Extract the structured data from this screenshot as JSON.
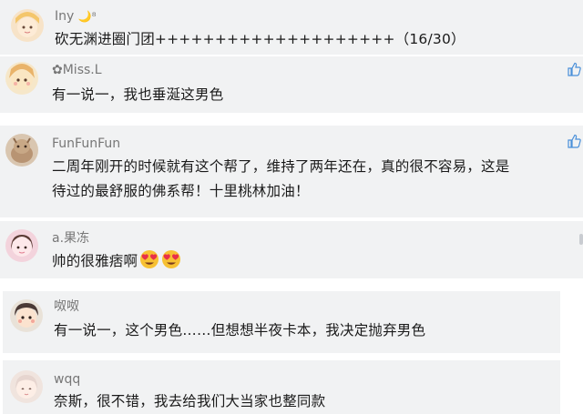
{
  "comments": [
    {
      "username": "Iny",
      "username_suffix": "🌙⁸",
      "text": "砍无渊进圈门团++++++++++++++++++++（16/30）"
    },
    {
      "username": "✿Miss.L",
      "text": "有一说一，我也垂涎这男色"
    },
    {
      "username": "FunFunFun",
      "text_line1": "二周年刚开的时候就有这个帮了，维持了两年还在，真的很不容易，这是",
      "text_line2": "待过的最舒服的佛系帮！十里桃林加油！"
    },
    {
      "username": "a.果冻",
      "text": "帅的很雅痞啊"
    },
    {
      "username": "呶呶",
      "text": "有一说一，这个男色……但想想半夜卡本，我决定抛弃男色"
    },
    {
      "username": "wqq",
      "text": "奈斯，很不错，我去给我们大当家也整同款"
    }
  ],
  "icons": {
    "like": "thumbs-up-icon",
    "emoji": "heart-eyes-emoji"
  }
}
